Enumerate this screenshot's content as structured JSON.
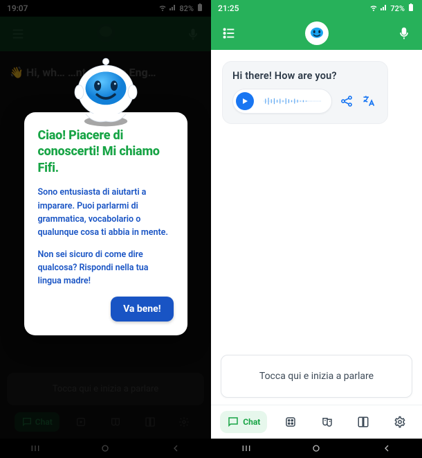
{
  "left": {
    "status": {
      "time": "19:07",
      "battery": "82%"
    },
    "background_message": "👋 Hi, wh…  …nt to learn Eng…",
    "modal": {
      "title": "Ciao! Piacere di conoscerti! Mi chiamo Fifi.",
      "p1": "Sono entusiasta di aiutarti a imparare. Puoi parlarmi di grammatica, vocabolario o qualunque cosa ti abbia in mente.",
      "p2": "Non sei sicuro di come dire qualcosa? Rispondi nella tua lingua madre!",
      "button": "Va bene!"
    },
    "input_placeholder": "Tocca qui e inizia a parlare",
    "tabs": {
      "chat": "Chat"
    }
  },
  "right": {
    "status": {
      "time": "21:25",
      "battery": "72%"
    },
    "bubble_text": "Hi there! How are you?",
    "input_placeholder": "Tocca qui e inizia a parlare",
    "tabs": {
      "chat": "Chat"
    }
  }
}
